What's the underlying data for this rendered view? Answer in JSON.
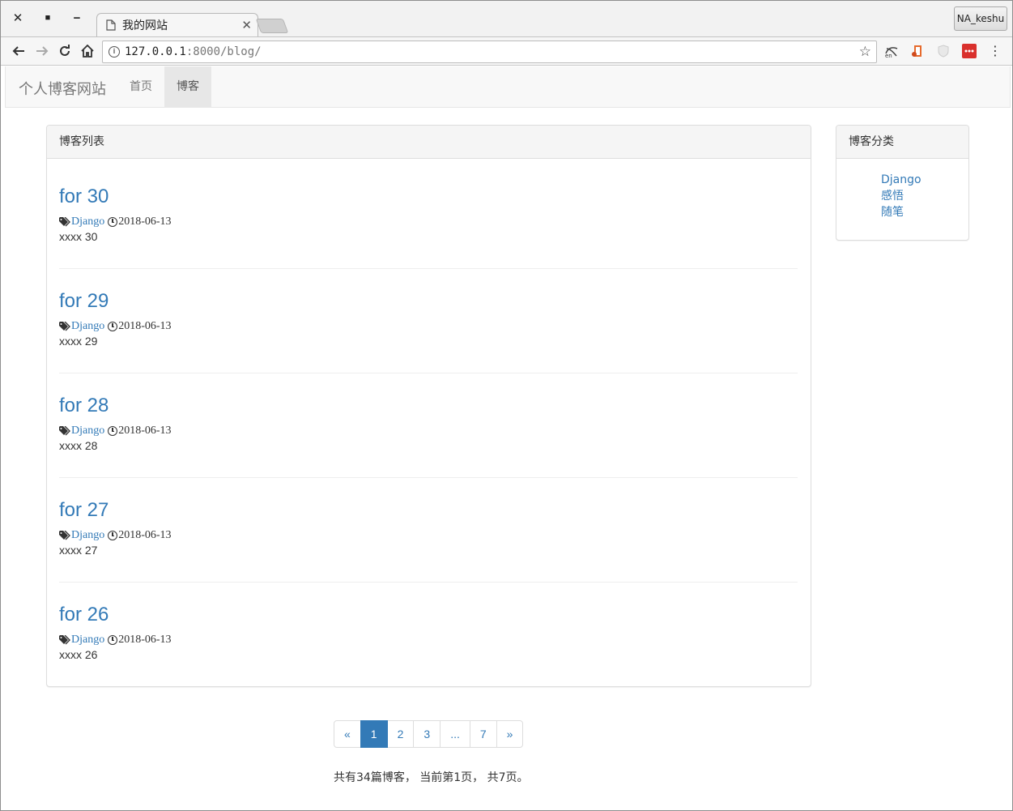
{
  "browser": {
    "tab_title": "我的网站",
    "profile_name": "NA_keshu",
    "url_host": "127.0.0.1",
    "url_rest": ":8000/blog/"
  },
  "navbar": {
    "brand": "个人博客网站",
    "links": [
      "首页",
      "博客"
    ]
  },
  "blog_list": {
    "heading": "博客列表",
    "posts": [
      {
        "title": "for 30",
        "tag": "Django",
        "date": "2018-06-13",
        "summary": "xxxx 30"
      },
      {
        "title": "for 29",
        "tag": "Django",
        "date": "2018-06-13",
        "summary": "xxxx 29"
      },
      {
        "title": "for 28",
        "tag": "Django",
        "date": "2018-06-13",
        "summary": "xxxx 28"
      },
      {
        "title": "for 27",
        "tag": "Django",
        "date": "2018-06-13",
        "summary": "xxxx 27"
      },
      {
        "title": "for 26",
        "tag": "Django",
        "date": "2018-06-13",
        "summary": "xxxx 26"
      }
    ]
  },
  "categories": {
    "heading": "博客分类",
    "items": [
      "Django",
      "感悟",
      "随笔"
    ]
  },
  "pagination": {
    "prev": "«",
    "pages": [
      "1",
      "2",
      "3",
      "...",
      "7"
    ],
    "next": "»",
    "current": "1",
    "summary": "共有34篇博客， 当前第1页， 共7页。"
  },
  "colors": {
    "link": "#337ab7",
    "navbar_bg": "#f8f8f8",
    "active_page": "#337ab7"
  }
}
